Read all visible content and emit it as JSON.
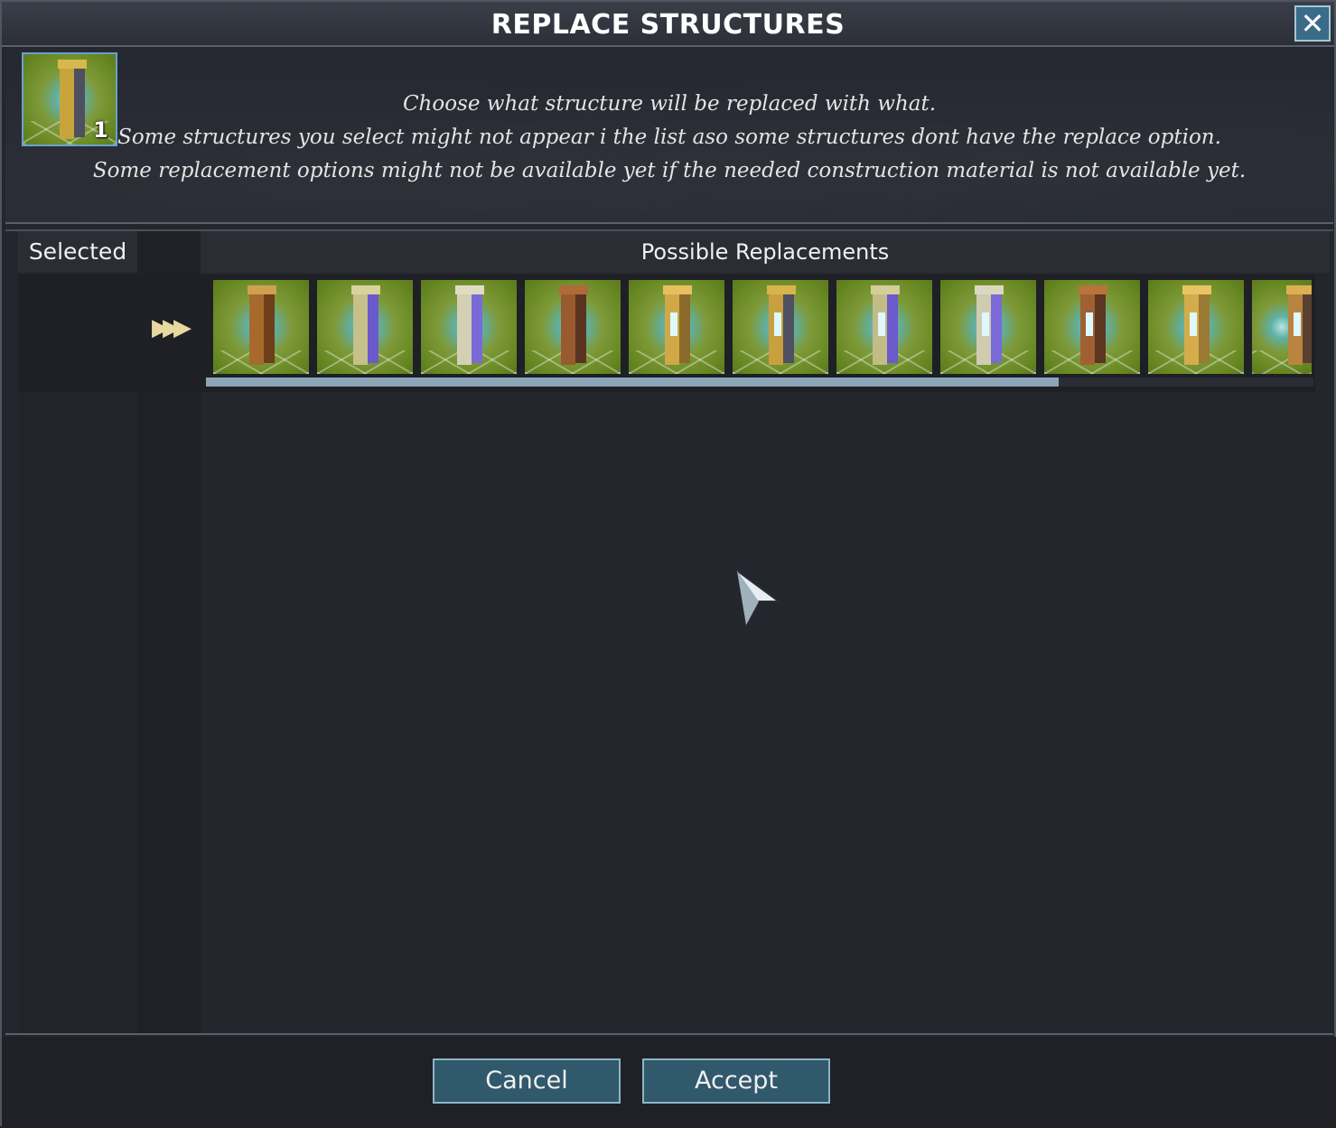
{
  "window": {
    "title": "REPLACE STRUCTURES",
    "close_label": "✕"
  },
  "description": {
    "line1": "Choose what structure will be replaced with what.",
    "line2": "Some structures you select might not appear i the list aso some structures dont have the replace option.",
    "line3": "Some replacement options might not be available yet if the needed construction material is not available yet."
  },
  "selected": {
    "header": "Selected",
    "item": {
      "icon": "wood-pillar-icon",
      "count": "1"
    }
  },
  "replacements": {
    "header": "Possible Replacements",
    "arrow_glyph": "▶▶▶",
    "items": [
      {
        "icon": "wooden-log-pillar-icon"
      },
      {
        "icon": "cobblestone-pillar-icon"
      },
      {
        "icon": "stone-brick-pillar-icon"
      },
      {
        "icon": "clay-pillar-icon"
      },
      {
        "icon": "wooden-window-pillar-icon"
      },
      {
        "icon": "wooden-arch-pillar-icon"
      },
      {
        "icon": "cobblestone-window-pillar-icon"
      },
      {
        "icon": "stone-window-pillar-icon"
      },
      {
        "icon": "clay-window-pillar-icon"
      },
      {
        "icon": "plank-window-pillar-icon"
      },
      {
        "icon": "ornate-wooden-pillar-icon"
      }
    ],
    "scroll_position": 0,
    "scroll_visible_fraction": 0.77
  },
  "footer": {
    "cancel_label": "Cancel",
    "accept_label": "Accept"
  },
  "colors": {
    "accent": "#30596c",
    "button_border": "#8fb4c4",
    "tile_green": "#6a8a24",
    "tile_glow": "#b6e6e0"
  }
}
